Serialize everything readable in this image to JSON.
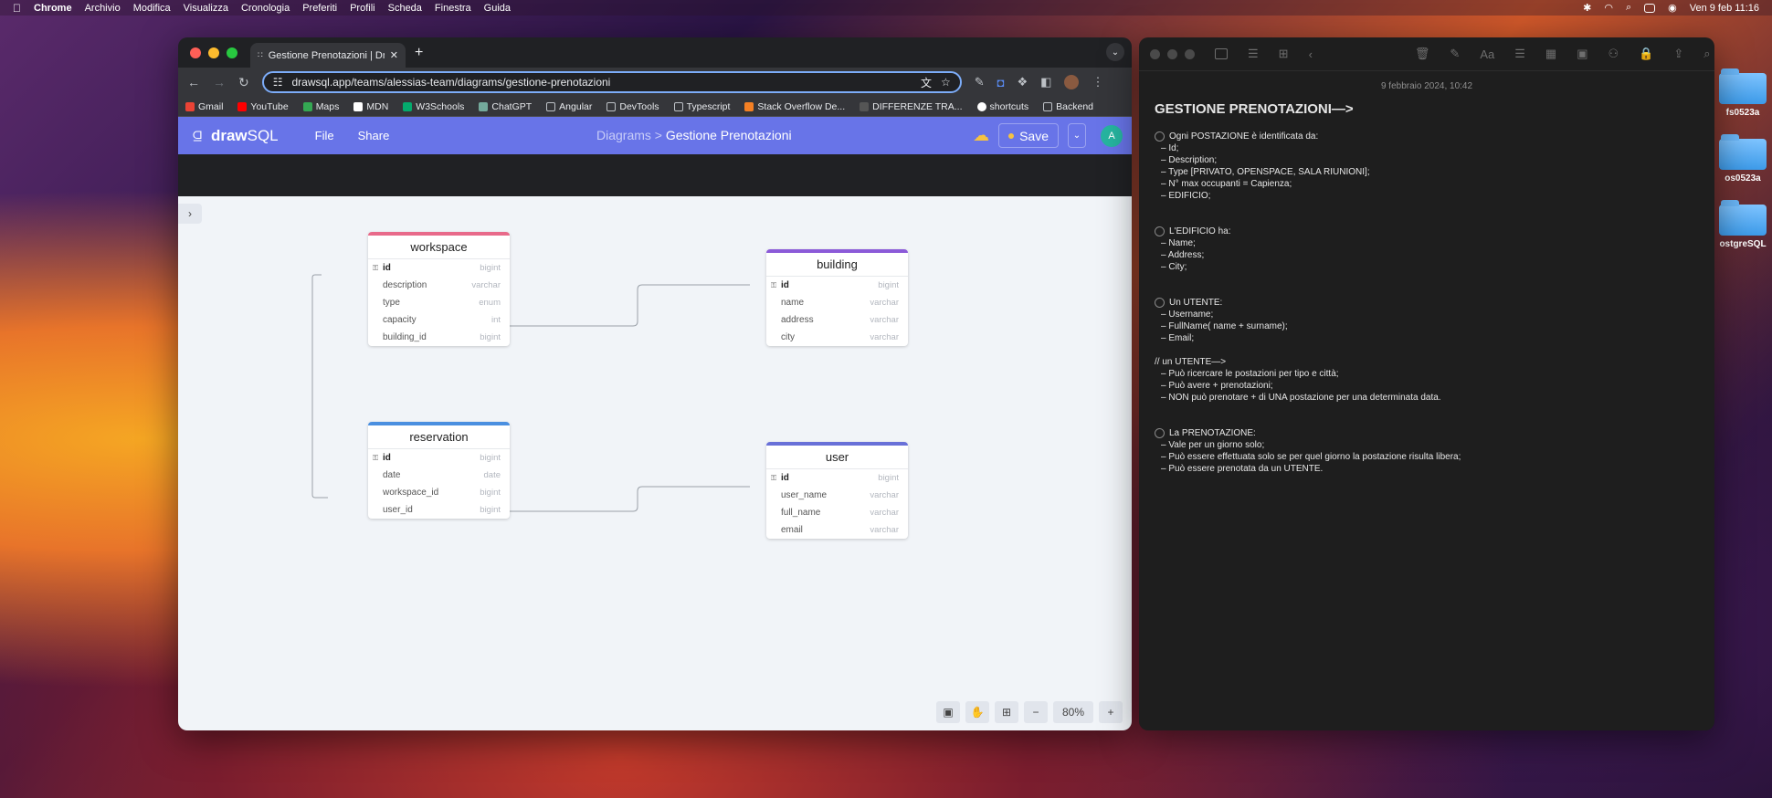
{
  "menubar": {
    "app": "Chrome",
    "items": [
      "Archivio",
      "Modifica",
      "Visualizza",
      "Cronologia",
      "Preferiti",
      "Profili",
      "Scheda",
      "Finestra",
      "Guida"
    ],
    "datetime": "Ven 9 feb  11:16"
  },
  "desktop_icons": [
    "fs0523a",
    "os0523a",
    "ostgreSQL"
  ],
  "chrome": {
    "tab_title": "Gestione Prenotazioni | Drav",
    "url": "drawsql.app/teams/alessias-team/diagrams/gestione-prenotazioni",
    "bookmarks": [
      "Gmail",
      "YouTube",
      "Maps",
      "MDN",
      "W3Schools",
      "ChatGPT",
      "Angular",
      "DevTools",
      "Typescript",
      "Stack Overflow De...",
      "DIFFERENZE TRA...",
      "shortcuts",
      "Backend"
    ]
  },
  "drawsql": {
    "brand_a": "draw",
    "brand_b": "SQL",
    "menu_file": "File",
    "menu_share": "Share",
    "crumb_parent": "Diagrams >",
    "crumb_current": "Gestione Prenotazioni",
    "save_label": "Save",
    "avatar": "A",
    "zoom": "80%",
    "tables": [
      {
        "name": "workspace",
        "color": "#e86a8a",
        "columns": [
          [
            "id",
            "bigint"
          ],
          [
            "description",
            "varchar"
          ],
          [
            "type",
            "enum"
          ],
          [
            "capacity",
            "int"
          ],
          [
            "building_id",
            "bigint"
          ]
        ]
      },
      {
        "name": "building",
        "color": "#8b5ad8",
        "columns": [
          [
            "id",
            "bigint"
          ],
          [
            "name",
            "varchar"
          ],
          [
            "address",
            "varchar"
          ],
          [
            "city",
            "varchar"
          ]
        ]
      },
      {
        "name": "reservation",
        "color": "#4a8fe0",
        "columns": [
          [
            "id",
            "bigint"
          ],
          [
            "date",
            "date"
          ],
          [
            "workspace_id",
            "bigint"
          ],
          [
            "user_id",
            "bigint"
          ]
        ]
      },
      {
        "name": "user",
        "color": "#6870d8",
        "columns": [
          [
            "id",
            "bigint"
          ],
          [
            "user_name",
            "varchar"
          ],
          [
            "full_name",
            "varchar"
          ],
          [
            "email",
            "varchar"
          ]
        ]
      }
    ]
  },
  "notes": {
    "date": "9 febbraio 2024, 10:42",
    "title": "GESTIONE PRENOTAZIONI—>",
    "s1_head": "Ogni POSTAZIONE è identificata da:",
    "s1": [
      "Id;",
      "Description;",
      "Type [PRIVATO, OPENSPACE, SALA RIUNIONI];",
      "N° max occupanti = Capienza;",
      "EDIFICIO;"
    ],
    "s2_head": "L'EDIFICIO ha:",
    "s2": [
      "Name;",
      "Address;",
      "City;"
    ],
    "s3_head": "Un UTENTE:",
    "s3": [
      "Username;",
      "FullName( name + surname);",
      "Email;"
    ],
    "s4_head": "// un UTENTE—>",
    "s4": [
      "Può ricercare le postazioni per tipo e città;",
      "Può avere + prenotazioni;",
      "NON può prenotare + di UNA postazione per una determinata data."
    ],
    "s5_head": "La PRENOTAZIONE:",
    "s5": [
      "Vale per un giorno solo;",
      "Può essere effettuata solo se per quel giorno la postazione risulta libera;",
      "Può essere prenotata da un UTENTE."
    ]
  }
}
